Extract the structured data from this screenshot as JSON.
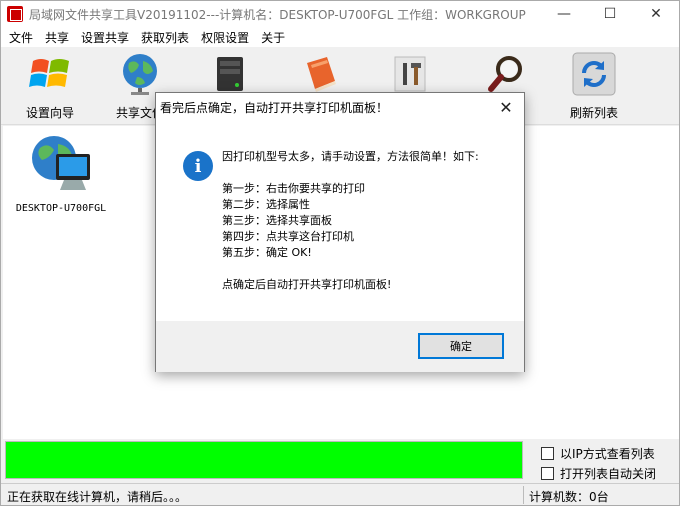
{
  "window": {
    "title": "局域网文件共享工具V20191102---计算机名：DESKTOP-U700FGL  工作组：WORKGROUP",
    "controls": {
      "minimize": "—",
      "maximize": "☐",
      "close": "✕"
    }
  },
  "menu": [
    "文件",
    "共享",
    "设置共享",
    "获取列表",
    "权限设置",
    "关于"
  ],
  "toolbar": {
    "items": [
      {
        "label": "设置向导",
        "icon": "windows-logo-icon"
      },
      {
        "label": "共享文件",
        "icon": "globe-icon"
      },
      {
        "label": "",
        "icon": "server-icon"
      },
      {
        "label": "",
        "icon": "book-icon"
      },
      {
        "label": "",
        "icon": "tools-icon"
      },
      {
        "label": "",
        "icon": "magnifier-icon"
      },
      {
        "label": "刷新列表",
        "icon": "refresh-icon"
      }
    ]
  },
  "computers": [
    {
      "name": "DESKTOP-U700FGL",
      "icon": "network-computer-icon"
    }
  ],
  "options": {
    "ip_view": "以IP方式查看列表",
    "auto_close": "打开列表自动关闭"
  },
  "progress": {
    "value": 1.0,
    "color": "#00ff00"
  },
  "status": {
    "left": "正在获取在线计算机，请稍后。。。",
    "right": "计算机数：0台"
  },
  "dialog": {
    "title": "看完后点确定，自动打开共享打印机面板！",
    "close": "✕",
    "lines": [
      "因打印机型号太多，请手动设置，方法很简单！如下:",
      "",
      "第一步：右击你要共享的打印",
      "第二步：选择属性",
      "第三步：选择共享面板",
      "第四步：点共享这台打印机",
      "第五步：确定  OK!",
      "",
      "点确定后自动打开共享打印机面板!"
    ],
    "ok_label": "确定"
  },
  "colors": {
    "accent": "#0078d7",
    "info": "#1a73c9"
  }
}
